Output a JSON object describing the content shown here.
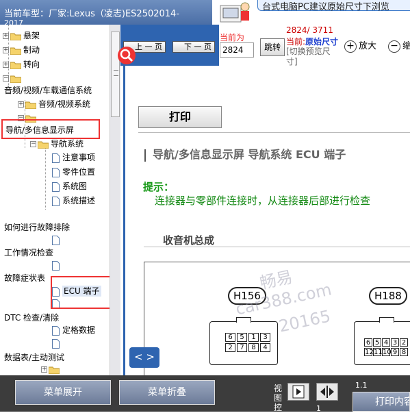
{
  "header": {
    "vehicle_prefix": "当前车型：",
    "vehicle_name": "厂家:Lexus（凌志)ES2502014-",
    "vehicle_year": "2017"
  },
  "banner": {
    "message": "台式电脑PC建议原始尺寸下浏览"
  },
  "tree": {
    "items": [
      {
        "label": "悬架"
      },
      {
        "label": "制动"
      },
      {
        "label": "转向"
      },
      {
        "label": "音频/视频/车载通信系统"
      },
      {
        "label": "音频/视频系统"
      },
      {
        "label": "导航/多信息显示屏"
      },
      {
        "label": "导航系统"
      },
      {
        "label": "注意事项"
      },
      {
        "label": "零件位置"
      },
      {
        "label": "系统图"
      },
      {
        "label": "系统描述"
      },
      {
        "label": "如何进行故障排除"
      },
      {
        "label": "工作情况检查"
      },
      {
        "label": "故障症状表"
      },
      {
        "label": "ECU 端子"
      },
      {
        "label": "DTC 检查/清除"
      },
      {
        "label": "定格数据"
      },
      {
        "label": "数据表/主动测试"
      }
    ]
  },
  "toolbar": {
    "prev_label": "上 一 页",
    "next_label": "下 一 页",
    "current_label": "当前为",
    "page_value": "2824",
    "jump_label": "跳转",
    "page_count": "2824/ 3711",
    "current_prefix": "当前:",
    "current_mode": "原始尺寸",
    "switch_text": "[切换预览尺寸]",
    "zoom_in_label": "放大",
    "zoom_out_label": "缩"
  },
  "document": {
    "print_label": "打印",
    "section_title": "导航/多信息显示屏  导航系统  ECU 端子",
    "tip_label": "提示：",
    "tip_text": "连接器与零部件连接时，从连接器后部进行检查",
    "subtitle": "收音机总成",
    "connectors": [
      {
        "label": "H156",
        "pins": [
          "6",
          "5",
          "1",
          "3",
          "2",
          "7",
          "8",
          "4"
        ]
      },
      {
        "label": "H188",
        "pins": [
          "6",
          "5",
          "4",
          "3",
          "2",
          "12",
          "11",
          "10",
          "9",
          "8"
        ]
      }
    ],
    "watermark_lines": [
      "畅易",
      "car388.com",
      "20165"
    ],
    "page_nav_label": "< >"
  },
  "bottom": {
    "expand_label": "菜单展开",
    "collapse_label": "菜单折叠",
    "view_label": "视图控",
    "page_indicator": "1.1",
    "page_small": "1",
    "print_content_label": "打印内容"
  }
}
